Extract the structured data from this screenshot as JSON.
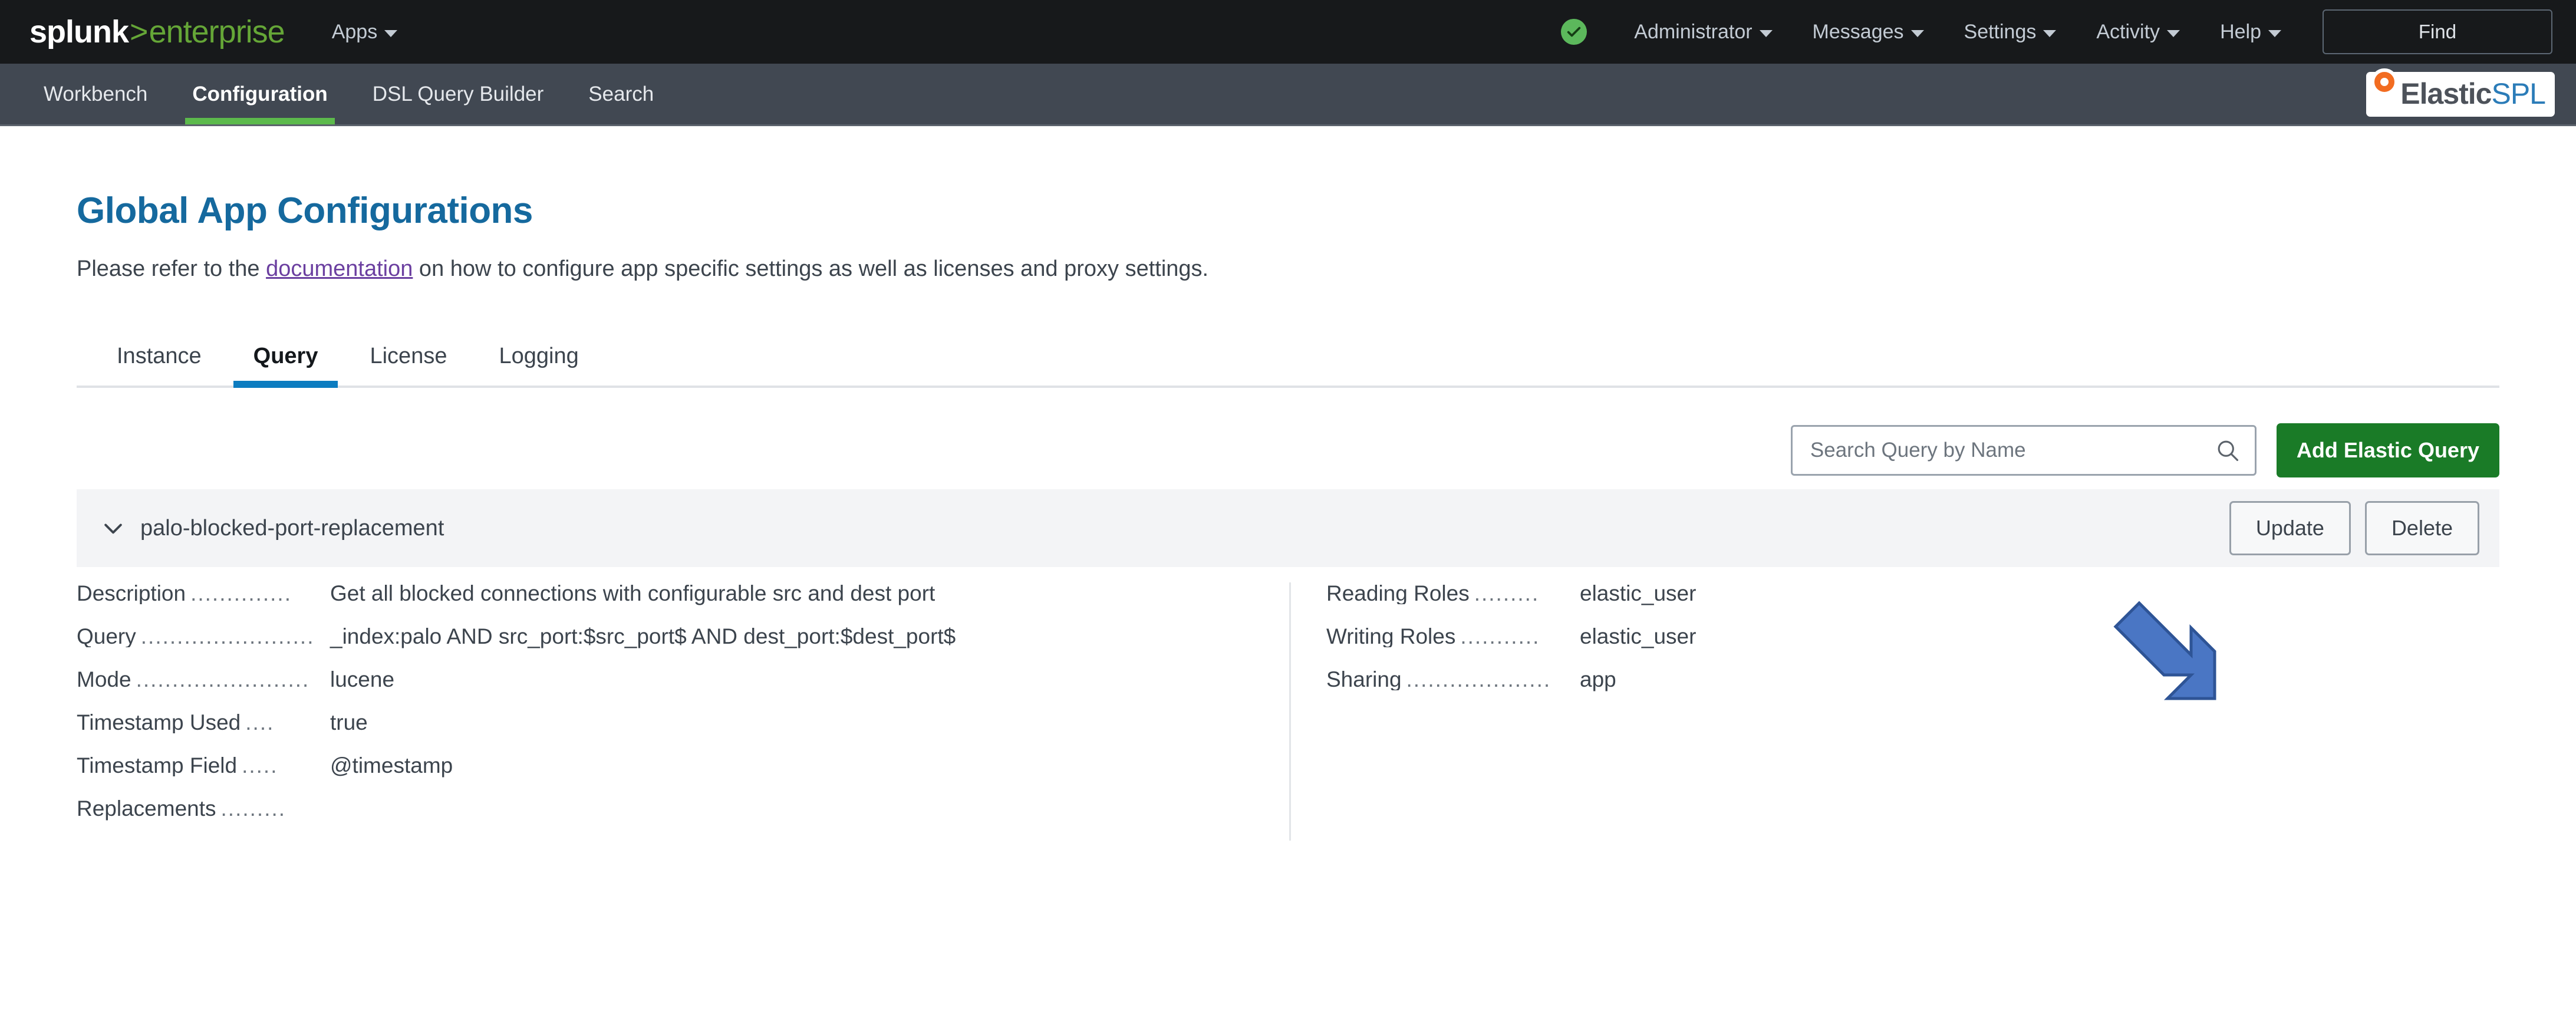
{
  "splunk_bar": {
    "logo": {
      "splunk": "splunk",
      "gt": "&gt;",
      "enterprise": "enterprise"
    },
    "apps_label": "Apps",
    "health_icon": "green-check-circle-icon",
    "menus": [
      "Administrator",
      "Messages",
      "Settings",
      "Activity",
      "Help"
    ],
    "find_label": "Find"
  },
  "app_bar": {
    "tabs": [
      {
        "label": "Workbench",
        "active": false
      },
      {
        "label": "Configuration",
        "active": true
      },
      {
        "label": "DSL Query Builder",
        "active": false
      },
      {
        "label": "Search",
        "active": false
      }
    ],
    "brand": {
      "elastic": "Elastic",
      "spl": "SPL"
    },
    "active_underline_color": "#5cba4c"
  },
  "main": {
    "title": "Global App Configurations",
    "description_before": "Please refer to the ",
    "description_link": "documentation",
    "description_after": " on how to configure app specific settings as well as licenses and proxy settings.",
    "title_color": "#15699e",
    "link_color": "#6b3fa0",
    "tabs": [
      {
        "label": "Instance",
        "active": false
      },
      {
        "label": "Query",
        "active": true
      },
      {
        "label": "License",
        "active": false
      },
      {
        "label": "Logging",
        "active": false
      }
    ],
    "active_tab_color": "#0c7cc0",
    "search": {
      "placeholder": "Search Query by Name",
      "value": ""
    },
    "add_button_label": "Add Elastic Query",
    "add_button_color": "#1a7b27",
    "annotation": {
      "type": "arrow",
      "direction": "down-right",
      "color": "#4472c4",
      "points_to": "Add Elastic Query"
    },
    "query_row": {
      "name": "palo-blocked-port-replacement",
      "expanded": true,
      "update_label": "Update",
      "delete_label": "Delete",
      "left_fields": [
        {
          "key": "Description",
          "dots": "..............",
          "value": "Get all blocked connections with configurable src and dest port"
        },
        {
          "key": "Query",
          "dots": "........................",
          "value": "_index:palo AND src_port:$src_port$ AND dest_port:$dest_port$"
        },
        {
          "key": "Mode",
          "dots": "........................",
          "value": "lucene"
        },
        {
          "key": "Timestamp Used",
          "dots": "....",
          "value": "true"
        },
        {
          "key": "Timestamp Field",
          "dots": ".....",
          "value": "@timestamp"
        },
        {
          "key": "Replacements",
          "dots": ".........",
          "value": ""
        }
      ],
      "right_fields": [
        {
          "key": "Reading Roles",
          "dots": ".........",
          "value": "elastic_user"
        },
        {
          "key": "Writing Roles",
          "dots": "...........",
          "value": "elastic_user"
        },
        {
          "key": "Sharing",
          "dots": "....................",
          "value": "app"
        }
      ]
    }
  }
}
